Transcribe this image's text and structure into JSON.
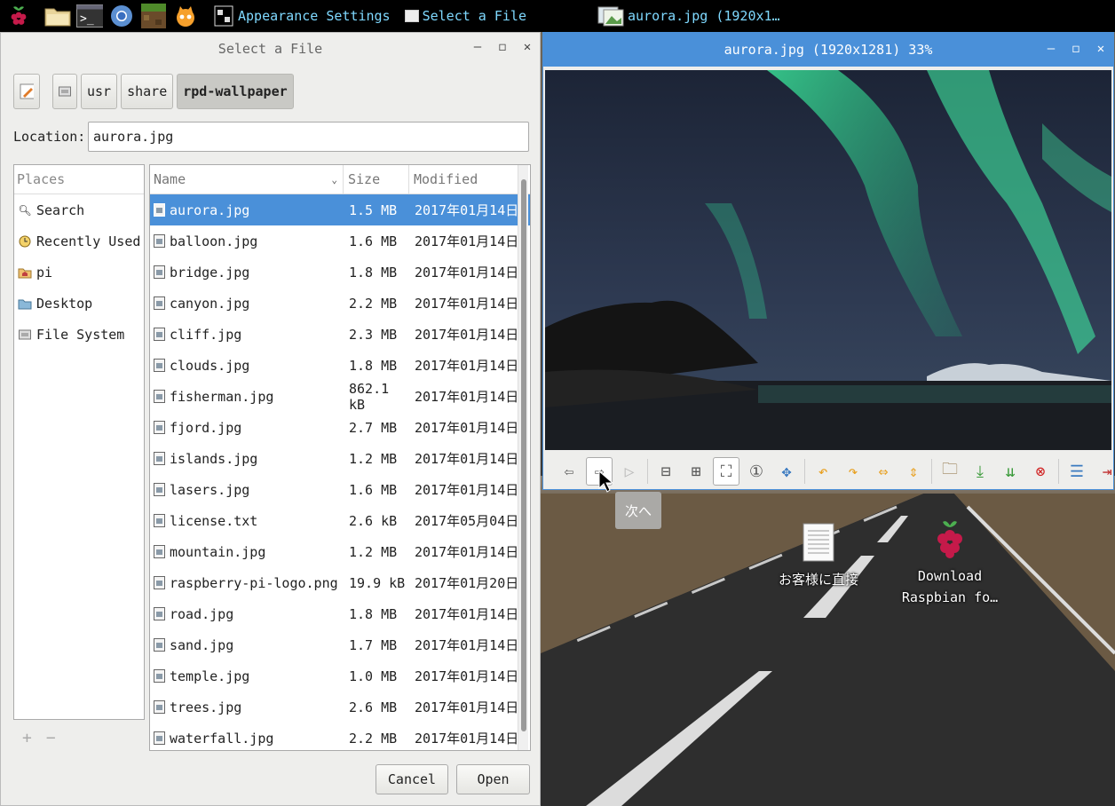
{
  "taskbar": {
    "launchers": [
      "raspberry-menu-icon",
      "file-manager-icon",
      "terminal-icon",
      "chromium-icon",
      "minecraft-icon",
      "scratch-icon"
    ],
    "tasks": [
      {
        "label": "Appearance Settings"
      },
      {
        "label": "Select a File"
      },
      {
        "label": "aurora.jpg (1920x1…"
      }
    ]
  },
  "file_dialog": {
    "title": "Select a File",
    "path": [
      {
        "label": ""
      },
      {
        "label": "usr"
      },
      {
        "label": "share"
      },
      {
        "label": "rpd-wallpaper",
        "active": true
      }
    ],
    "location_label": "Location:",
    "location_value": "aurora.jpg",
    "places": {
      "header": "Places",
      "items": [
        {
          "label": "Search",
          "icon": "search-icon"
        },
        {
          "label": "Recently Used",
          "icon": "clock-icon"
        },
        {
          "label": "pi",
          "icon": "home-folder-icon"
        },
        {
          "label": "Desktop",
          "icon": "folder-icon"
        },
        {
          "label": "File System",
          "icon": "drive-icon"
        }
      ],
      "add": "+",
      "remove": "−"
    },
    "columns": {
      "name": "Name",
      "size": "Size",
      "modified": "Modified"
    },
    "files": [
      {
        "name": "aurora.jpg",
        "size": "1.5 MB",
        "modified": "2017年01月14日",
        "selected": true
      },
      {
        "name": "balloon.jpg",
        "size": "1.6 MB",
        "modified": "2017年01月14日"
      },
      {
        "name": "bridge.jpg",
        "size": "1.8 MB",
        "modified": "2017年01月14日"
      },
      {
        "name": "canyon.jpg",
        "size": "2.2 MB",
        "modified": "2017年01月14日"
      },
      {
        "name": "cliff.jpg",
        "size": "2.3 MB",
        "modified": "2017年01月14日"
      },
      {
        "name": "clouds.jpg",
        "size": "1.8 MB",
        "modified": "2017年01月14日"
      },
      {
        "name": "fisherman.jpg",
        "size": "862.1 kB",
        "modified": "2017年01月14日"
      },
      {
        "name": "fjord.jpg",
        "size": "2.7 MB",
        "modified": "2017年01月14日"
      },
      {
        "name": "islands.jpg",
        "size": "1.2 MB",
        "modified": "2017年01月14日"
      },
      {
        "name": "lasers.jpg",
        "size": "1.6 MB",
        "modified": "2017年01月14日"
      },
      {
        "name": "license.txt",
        "size": "2.6 kB",
        "modified": "2017年05月04日"
      },
      {
        "name": "mountain.jpg",
        "size": "1.2 MB",
        "modified": "2017年01月14日"
      },
      {
        "name": "raspberry-pi-logo.png",
        "size": "19.9 kB",
        "modified": "2017年01月20日"
      },
      {
        "name": "road.jpg",
        "size": "1.8 MB",
        "modified": "2017年01月14日"
      },
      {
        "name": "sand.jpg",
        "size": "1.7 MB",
        "modified": "2017年01月14日"
      },
      {
        "name": "temple.jpg",
        "size": "1.0 MB",
        "modified": "2017年01月14日"
      },
      {
        "name": "trees.jpg",
        "size": "2.6 MB",
        "modified": "2017年01月14日"
      },
      {
        "name": "waterfall.jpg",
        "size": "2.2 MB",
        "modified": "2017年01月14日"
      }
    ],
    "cancel_label": "Cancel",
    "open_label": "Open"
  },
  "viewer": {
    "title": "aurora.jpg (1920x1281) 33%",
    "tooltip": "次へ",
    "toolbar": [
      "prev-icon",
      "next-icon",
      "slideshow-icon",
      "zoom-out-icon",
      "zoom-in-icon",
      "zoom-fit-icon",
      "zoom-original-icon",
      "fullscreen-icon",
      "rotate-left-icon",
      "rotate-right-icon",
      "flip-horizontal-icon",
      "flip-vertical-icon",
      "open-file-icon",
      "save-icon",
      "save-as-icon",
      "delete-icon",
      "preferences-icon",
      "exit-icon"
    ]
  },
  "desktop": {
    "icons": [
      {
        "label": "お客様に直接"
      },
      {
        "label": "Download Raspbian fo…"
      }
    ]
  },
  "colors": {
    "accent": "#4a90d9",
    "taskbar": "#000000",
    "task_text": "#7fd9ff"
  }
}
